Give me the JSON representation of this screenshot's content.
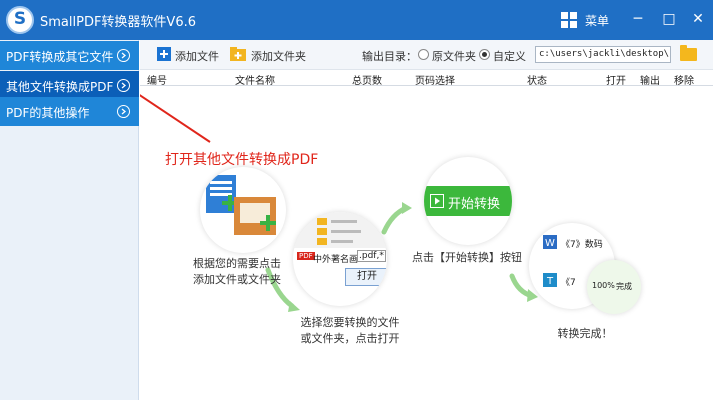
{
  "window": {
    "logo_letter": "S",
    "title": "SmallPDF转换器软件V6.6",
    "menu_label": "菜单",
    "minimize": "─",
    "maximize": "□",
    "close": "✕"
  },
  "sidebar": {
    "items": [
      {
        "label": "PDF转换成其它文件",
        "active": false
      },
      {
        "label": "其他文件转换成PDF",
        "active": true
      },
      {
        "label": "PDF的其他操作",
        "active": false
      }
    ]
  },
  "toolbar": {
    "add_file": "添加文件",
    "add_folder": "添加文件夹",
    "output_label": "输出目录：",
    "radio_original": "原文件夹",
    "radio_custom": "自定义",
    "output_path": "c:\\users\\jackli\\desktop\\"
  },
  "columns": [
    "编号",
    "文件名称",
    "总页数",
    "页码选择",
    "状态",
    "打开",
    "输出",
    "移除"
  ],
  "guide": {
    "title": "打开其他文件转换成PDF",
    "step1_caption": [
      "根据您的需要点击",
      "添加文件或文件夹"
    ],
    "step2_caption": [
      "选择您要转换的文件",
      "或文件夹，点击打开"
    ],
    "step2_file": "中外著名画",
    "step2_ext": ".pdf,*",
    "step2_open": "打开",
    "step3_button": "开始转换",
    "step3_caption": "点击【开始转换】按钮",
    "step4_item1": "《7》数码",
    "step4_item2": "《7",
    "step4_percent": "100%",
    "step4_done": "完成",
    "step4_caption": "转换完成！"
  },
  "colors": {
    "titlebar": "#1f6fc5",
    "sidebar_item": "#1f86d8",
    "sidebar_active": "#0b5fb8",
    "guide_title": "#e0261b",
    "start_green": "#3cb83c"
  }
}
